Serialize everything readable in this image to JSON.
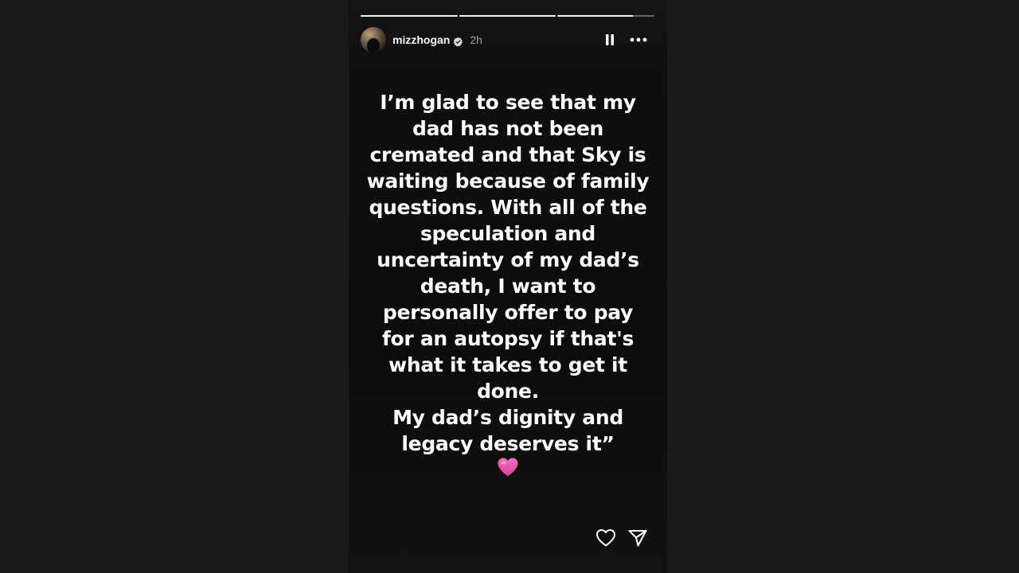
{
  "story": {
    "progress": [
      1.0,
      1.0,
      0.78
    ],
    "user": {
      "username": "mizzhogan",
      "verified": true,
      "time_ago": "2h"
    },
    "header_icons": [
      "pause-icon",
      "more-options-icon"
    ],
    "message_lines": [
      "I’m glad to see that my",
      "dad has not been",
      "cremated and that Sky is",
      "waiting because of family",
      "questions.  With all of the",
      "speculation and",
      "uncertainty of my dad’s",
      "death, I want to",
      "personally offer to pay",
      "for an autopsy if that's",
      "what it takes to get it",
      "done.",
      "My dad’s dignity and",
      "legacy deserves it”"
    ],
    "emoji": "pink-heart-icon",
    "footer_icons": [
      "like-heart-icon",
      "share-send-icon"
    ],
    "colors": {
      "background": "#1a1a1a",
      "story_background": "#111111",
      "text": "#ffffff",
      "emoji_pink": "#e44fa6"
    }
  }
}
